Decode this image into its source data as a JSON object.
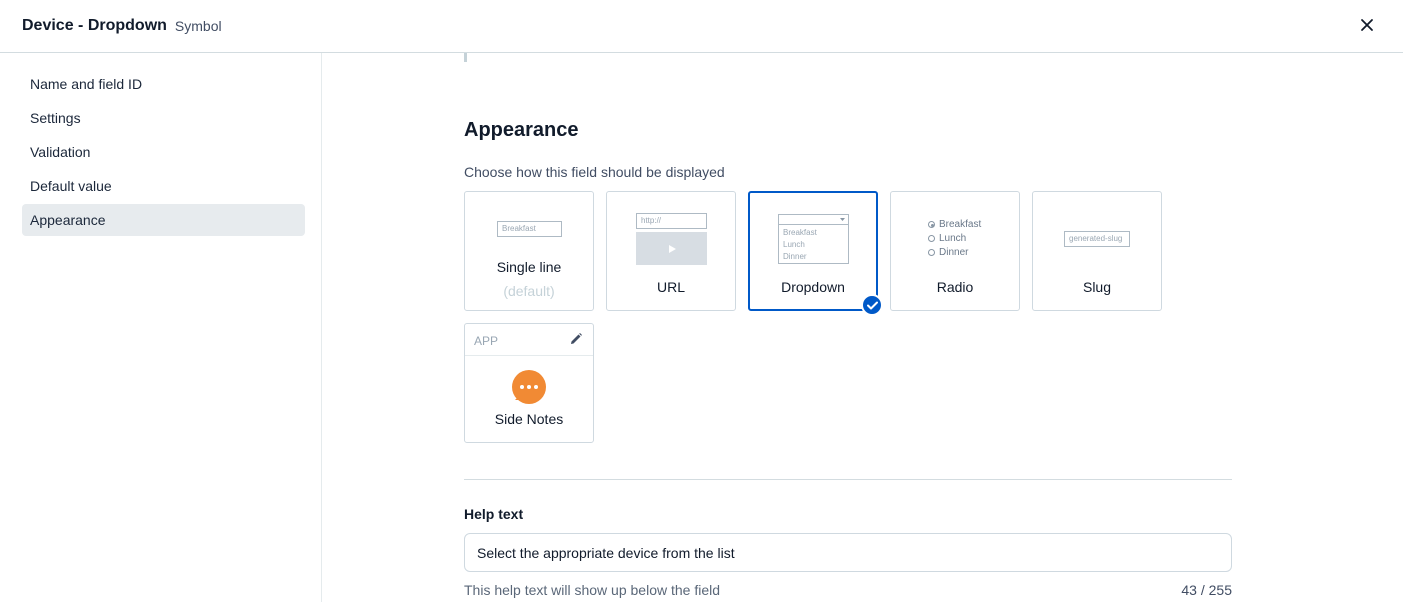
{
  "header": {
    "title": "Device - Dropdown",
    "subtitle": "Symbol"
  },
  "sidebar": {
    "items": [
      {
        "label": "Name and field ID"
      },
      {
        "label": "Settings"
      },
      {
        "label": "Validation"
      },
      {
        "label": "Default value"
      },
      {
        "label": "Appearance",
        "active": true
      }
    ]
  },
  "appearance": {
    "title": "Appearance",
    "description": "Choose how this field should be displayed",
    "selected": "Dropdown",
    "options": [
      {
        "label": "Single line",
        "sublabel": "(default)",
        "preview_text": "Breakfast"
      },
      {
        "label": "URL",
        "preview_text": "http://"
      },
      {
        "label": "Dropdown",
        "preview_items": [
          "Breakfast",
          "Lunch",
          "Dinner"
        ]
      },
      {
        "label": "Radio",
        "preview_items": [
          "Breakfast",
          "Lunch",
          "Dinner"
        ]
      },
      {
        "label": "Slug",
        "preview_text": "generated-slug"
      }
    ],
    "app": {
      "tag": "APP",
      "label": "Side Notes",
      "icon": "chat-bubble-icon",
      "icon_color": "#f18a34"
    }
  },
  "help": {
    "label": "Help text",
    "value": "Select the appropriate device from the list",
    "hint": "This help text will show up below the field",
    "count": "43 / 255"
  },
  "colors": {
    "accent": "#0059c8",
    "active_nav": "#e7ebee",
    "border": "#cfd9e0"
  }
}
